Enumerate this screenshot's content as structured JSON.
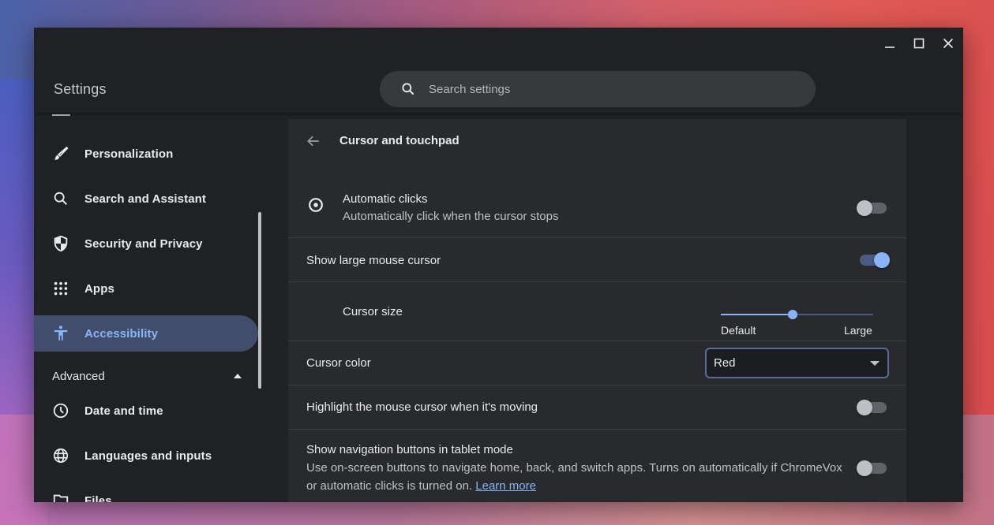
{
  "window": {
    "controls": {
      "minimize": "minimize",
      "maximize": "maximize",
      "close": "close"
    }
  },
  "header": {
    "title": "Settings",
    "search": {
      "placeholder": "Search settings",
      "value": ""
    }
  },
  "sidebar": {
    "items": [
      {
        "label": "Personalization",
        "icon": "brush-icon"
      },
      {
        "label": "Search and Assistant",
        "icon": "search-icon"
      },
      {
        "label": "Security and Privacy",
        "icon": "shield-icon"
      },
      {
        "label": "Apps",
        "icon": "apps-grid-icon"
      },
      {
        "label": "Accessibility",
        "icon": "accessibility-icon",
        "active": true
      }
    ],
    "advanced_label": "Advanced",
    "advanced_items": [
      {
        "label": "Date and time",
        "icon": "clock-icon"
      },
      {
        "label": "Languages and inputs",
        "icon": "globe-icon"
      },
      {
        "label": "Files",
        "icon": "folder-icon"
      }
    ]
  },
  "main": {
    "page_title": "Cursor and touchpad",
    "automatic_clicks": {
      "label": "Automatic clicks",
      "sublabel": "Automatically click when the cursor stops",
      "enabled": false
    },
    "large_cursor": {
      "label": "Show large mouse cursor",
      "enabled": true
    },
    "cursor_size": {
      "label": "Cursor size",
      "min_label": "Default",
      "max_label": "Large",
      "value_fraction": 0.47
    },
    "cursor_color": {
      "label": "Cursor color",
      "selected": "Red"
    },
    "highlight_cursor": {
      "label": "Highlight the mouse cursor when it's moving",
      "enabled": false
    },
    "nav_buttons": {
      "label": "Show navigation buttons in tablet mode",
      "sublabel_line1": "Use on-screen buttons to navigate home, back, and switch apps. Turns on automatically if ChromeVox",
      "sublabel_line2": "or automatic clicks is turned on.",
      "link_label": "Learn more",
      "enabled": false
    }
  },
  "colors": {
    "accent": "#8ab4f8",
    "active_nav_bg": "#414e6b",
    "window_bg": "#202124",
    "panel_bg": "#292a2d"
  }
}
